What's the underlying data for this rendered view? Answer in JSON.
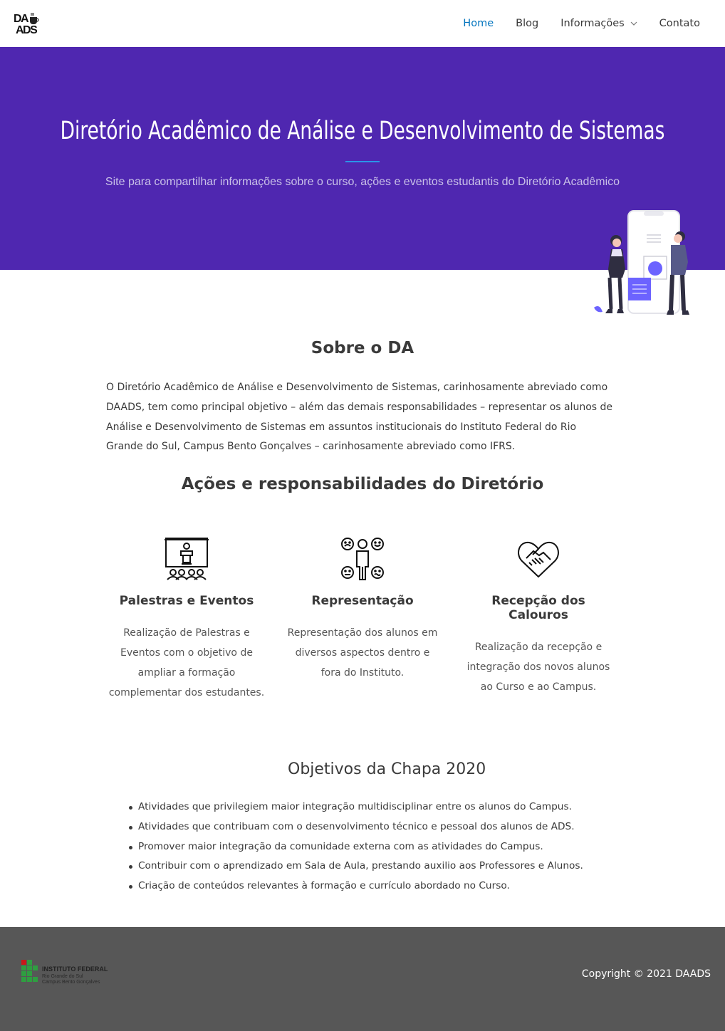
{
  "header": {
    "logo_text": "DAADS",
    "nav": [
      {
        "label": "Home",
        "active": true
      },
      {
        "label": "Blog"
      },
      {
        "label": "Informações",
        "icon": "chevron-down-icon"
      },
      {
        "label": "Contato"
      }
    ]
  },
  "hero": {
    "title": "Diretório Acadêmico de Análise e Desenvolvimento de Sistemas",
    "subtitle": "Site para compartilhar informações sobre o curso, ações e eventos estudantis do Diretório Acadêmico"
  },
  "about": {
    "title": "Sobre o DA",
    "text": "O Diretório Acadêmico de Análise e Desenvolvimento de Sistemas, carinhosamente abreviado como DAADS, tem como principal objetivo – além das demais responsabilidades – representar os alunos de Análise e Desenvolvimento de Sistemas em assuntos institucionais do Instituto Federal do Rio Grande do Sul, Campus Bento Gonçalves – carinhosamente abreviado como IFRS."
  },
  "actions": {
    "title": "Ações e responsabilidades do Diretório",
    "cards": [
      {
        "icon": "presentation-icon",
        "title": "Palestras e Eventos",
        "text": "Realização de Palestras e Eventos com o objetivo de ampliar a formação complementar dos estudantes."
      },
      {
        "icon": "representation-icon",
        "title": "Representação",
        "text": "Representação dos alunos em diversos aspectos dentro e fora do Instituto."
      },
      {
        "icon": "handshake-heart-icon",
        "title": "Recepção dos Calouros",
        "text": "Realização da recepção e integração dos novos alunos ao Curso e ao Campus."
      }
    ]
  },
  "objectives": {
    "title": "Objetivos da Chapa 2020",
    "items": [
      "Atividades que privilegiem maior integração multidisciplinar entre os alunos do Campus.",
      "Atividades que contribuam com o desenvolvimento técnico e pessoal dos alunos de ADS.",
      "Promover maior integração da comunidade externa com as atividades do Campus.",
      "Contribuir com o aprendizado em Sala de Aula, prestando auxilio aos Professores e Alunos.",
      "Criação de conteúdos relevantes à formação e currículo abordado no Curso."
    ]
  },
  "footer": {
    "logo_lines": [
      "INSTITUTO FEDERAL",
      "Rio Grande do Sul",
      "Campus Bento Gonçalves"
    ],
    "copyright": "Copyright © 2021 DAADS"
  },
  "colors": {
    "hero_bg": "#4f27b0",
    "accent": "#0274be",
    "footer_bg": "#575757"
  }
}
